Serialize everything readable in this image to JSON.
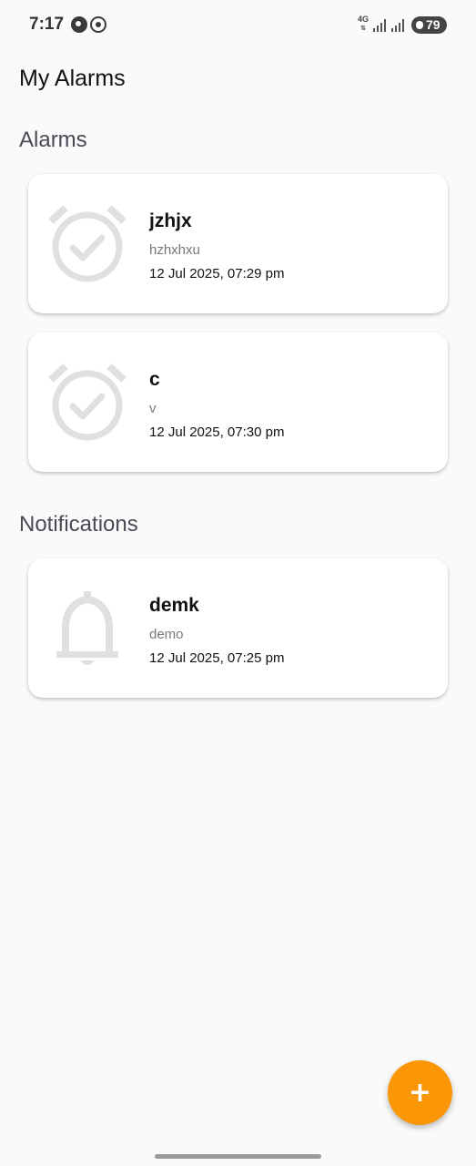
{
  "status_bar": {
    "time": "7:17",
    "network": "4G",
    "battery": "79"
  },
  "app": {
    "title": "My Alarms"
  },
  "sections": {
    "alarms": {
      "heading": "Alarms",
      "items": [
        {
          "title": "jzhjx",
          "subtitle": "hzhxhxu",
          "time": "12 Jul 2025, 07:29 pm",
          "icon": "alarm-check-icon"
        },
        {
          "title": "c",
          "subtitle": "v",
          "time": "12 Jul 2025, 07:30 pm",
          "icon": "alarm-check-icon"
        }
      ]
    },
    "notifications": {
      "heading": "Notifications",
      "items": [
        {
          "title": "demk",
          "subtitle": "demo",
          "time": "12 Jul 2025, 07:25 pm",
          "icon": "bell-icon"
        }
      ]
    }
  },
  "fab": {
    "label": "+",
    "icon": "plus-icon",
    "color": "#fb9607"
  },
  "colors": {
    "background": "#fafafa",
    "card": "#ffffff",
    "icon_gray": "#e0e0e0"
  }
}
